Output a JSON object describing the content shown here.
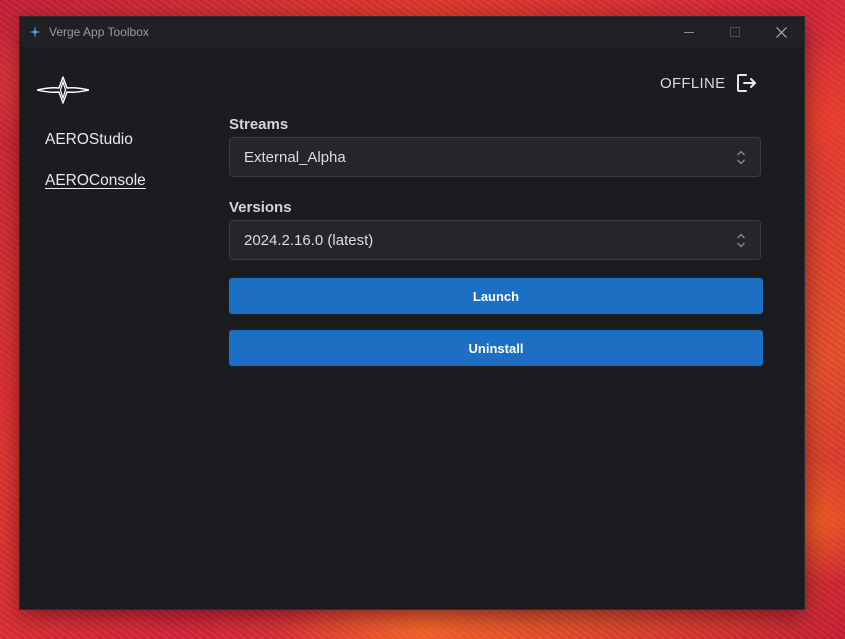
{
  "window": {
    "title": "Verge App Toolbox",
    "icon": "verge-star-icon"
  },
  "header": {
    "status": "OFFLINE",
    "status_icon": "logout-icon"
  },
  "sidebar": {
    "items": [
      {
        "label": "AEROStudio",
        "active": false
      },
      {
        "label": "AEROConsole",
        "active": true
      }
    ]
  },
  "main": {
    "streams": {
      "label": "Streams",
      "value": "External_Alpha"
    },
    "versions": {
      "label": "Versions",
      "value": "2024.2.16.0 (latest)"
    },
    "buttons": {
      "launch": "Launch",
      "uninstall": "Uninstall"
    }
  },
  "colors": {
    "accent": "#1d6fc3",
    "window_bg": "#1b1c20",
    "titlebar_bg": "#202125",
    "select_bg": "#25262b"
  }
}
